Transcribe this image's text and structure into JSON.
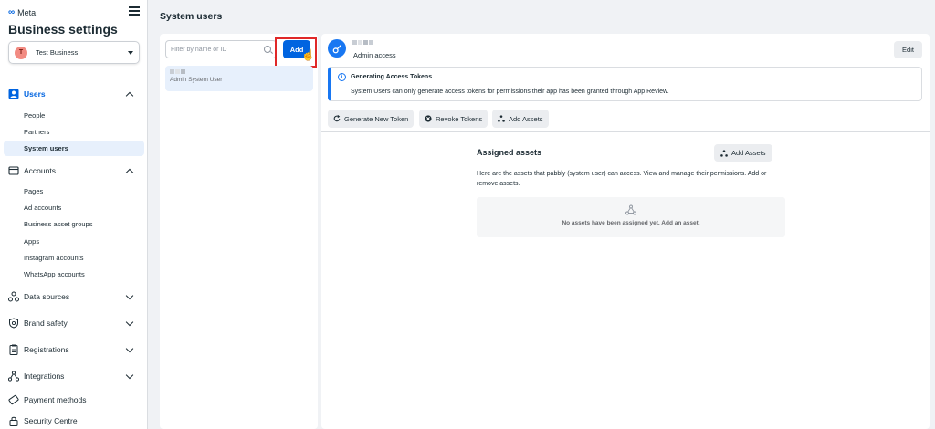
{
  "sidebar": {
    "brand": "Meta",
    "title": "Business settings",
    "business": {
      "initial": "T",
      "name": "Test Business"
    },
    "sections": [
      {
        "label": "Users",
        "icon": "users-icon"
      },
      {
        "label": "Accounts",
        "icon": "accounts-icon"
      },
      {
        "label": "Data sources",
        "icon": "data-sources-icon"
      },
      {
        "label": "Brand safety",
        "icon": "shield-icon"
      },
      {
        "label": "Registrations",
        "icon": "clipboard-icon"
      },
      {
        "label": "Integrations",
        "icon": "integrations-icon"
      },
      {
        "label": "Payment methods",
        "icon": "payment-icon"
      },
      {
        "label": "Security Centre",
        "icon": "lock-icon"
      }
    ],
    "users_items": [
      "People",
      "Partners",
      "System users"
    ],
    "accounts_items": [
      "Pages",
      "Ad accounts",
      "Business asset groups",
      "Apps",
      "Instagram accounts",
      "WhatsApp accounts"
    ]
  },
  "header": {
    "title": "System users"
  },
  "list": {
    "search_placeholder": "Filter by name or ID",
    "add_label": "Add",
    "selected_user_role": "Admin System User"
  },
  "detail": {
    "access": "Admin access",
    "edit_label": "Edit",
    "info_title": "Generating Access Tokens",
    "info_body": "System Users can only generate access tokens for permissions their app has been granted through App Review.",
    "actions": [
      "Generate New Token",
      "Revoke Tokens",
      "Add Assets"
    ],
    "assets_title": "Assigned assets",
    "assets_add_label": "Add Assets",
    "assets_desc": "Here are the assets that pabbly (system user) can access. View and manage their permissions. Add or remove assets.",
    "empty_text": "No assets have been assigned yet. Add an asset."
  },
  "colors": {
    "accent": "#0064e0",
    "active_bg": "#e7f0fc",
    "highlight": "#e02828"
  }
}
